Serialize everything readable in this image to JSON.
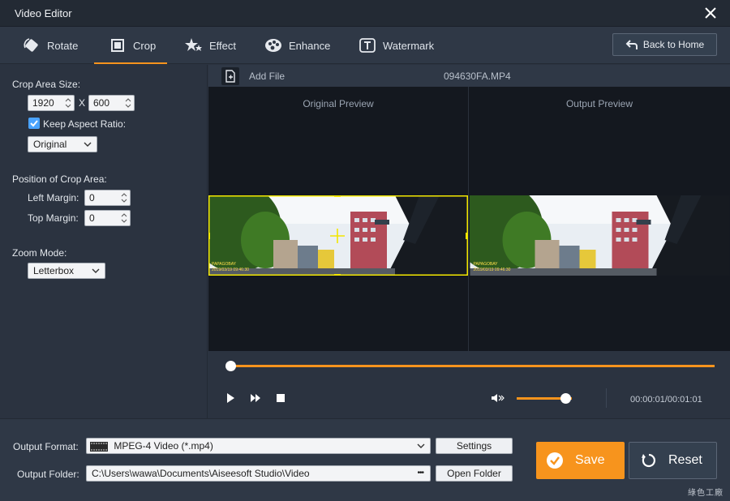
{
  "window": {
    "title": "Video Editor"
  },
  "tabs": [
    {
      "label": "Rotate",
      "icon": "rotate-icon",
      "active": false
    },
    {
      "label": "Crop",
      "icon": "crop-icon",
      "active": true
    },
    {
      "label": "Effect",
      "icon": "effect-icon",
      "active": false
    },
    {
      "label": "Enhance",
      "icon": "enhance-icon",
      "active": false
    },
    {
      "label": "Watermark",
      "icon": "watermark-icon",
      "active": false
    }
  ],
  "header": {
    "back_home_label": "Back to Home"
  },
  "crop": {
    "area_size_label": "Crop Area Size:",
    "width": "1920",
    "separator": "X",
    "height": "600",
    "keep_aspect_label": "Keep Aspect Ratio:",
    "keep_aspect_checked": true,
    "aspect_option": "Original",
    "position_label": "Position of Crop Area:",
    "left_margin_label": "Left Margin:",
    "left_margin": "0",
    "top_margin_label": "Top Margin:",
    "top_margin": "0",
    "zoom_label": "Zoom Mode:",
    "zoom_option": "Letterbox"
  },
  "preview": {
    "add_file_label": "Add File",
    "file_name": "094630FA.MP4",
    "original_caption": "Original Preview",
    "output_caption": "Output Preview",
    "video_stamp_line1": "PAPAGOBAY",
    "video_stamp_line2": "2019/03/19 09:46:30"
  },
  "playback": {
    "progress": 0,
    "volume": 0.88,
    "time": "00:00:01/00:01:01"
  },
  "output": {
    "format_label": "Output Format:",
    "format_value": "MPEG-4 Video (*.mp4)",
    "settings_label": "Settings",
    "folder_label": "Output Folder:",
    "folder_value": "C:\\Users\\wawa\\Documents\\Aiseesoft Studio\\Video",
    "browse_label": "•••",
    "open_folder_label": "Open Folder"
  },
  "actions": {
    "save_label": "Save",
    "reset_label": "Reset"
  },
  "watermark_text": "綠色工廠",
  "colors": {
    "accent": "#f7941d",
    "checkbox": "#4aa3ff",
    "crop_frame": "#f2e600"
  }
}
